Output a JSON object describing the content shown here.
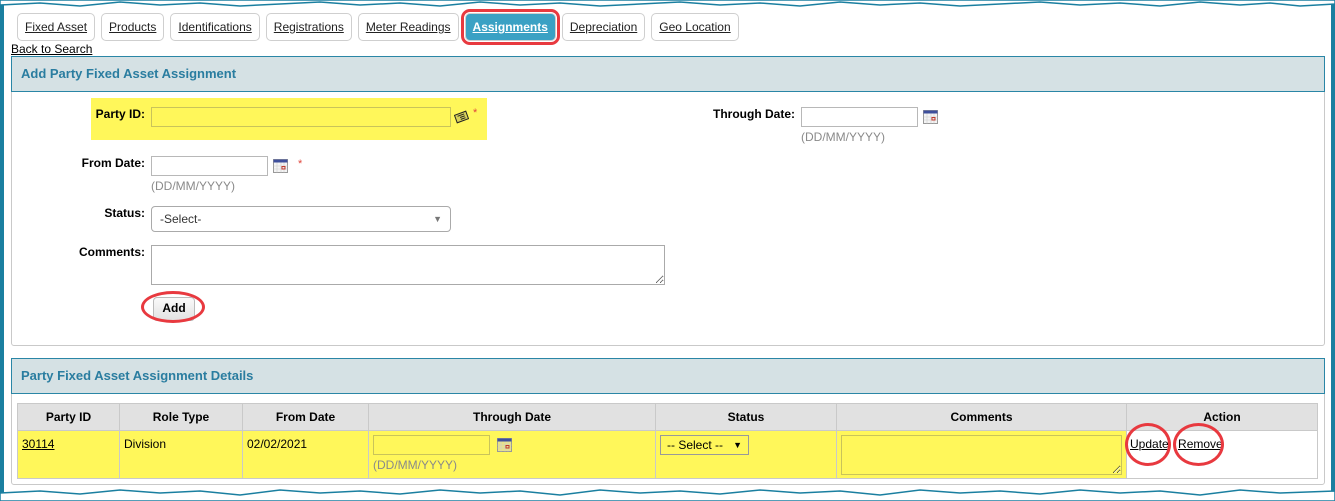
{
  "tabs": [
    {
      "label": "Fixed Asset",
      "active": false
    },
    {
      "label": "Products",
      "active": false
    },
    {
      "label": "Identifications",
      "active": false
    },
    {
      "label": "Registrations",
      "active": false
    },
    {
      "label": "Meter Readings",
      "active": false
    },
    {
      "label": "Assignments",
      "active": true
    },
    {
      "label": "Depreciation",
      "active": false
    },
    {
      "label": "Geo Location",
      "active": false
    }
  ],
  "back_link": "Back to Search",
  "add_form": {
    "title": "Add Party Fixed Asset Assignment",
    "party_id": {
      "label": "Party ID:",
      "value": "",
      "required": "*"
    },
    "from_date": {
      "label": "From Date:",
      "value": "",
      "hint": "(DD/MM/YYYY)",
      "required": "*"
    },
    "through_date": {
      "label": "Through Date:",
      "value": "",
      "hint": "(DD/MM/YYYY)"
    },
    "status": {
      "label": "Status:",
      "selected": "-Select-"
    },
    "comments": {
      "label": "Comments:",
      "value": ""
    },
    "add_button": "Add"
  },
  "details": {
    "title": "Party Fixed Asset Assignment Details",
    "columns": [
      "Party ID",
      "Role Type",
      "From Date",
      "Through Date",
      "Status",
      "Comments",
      "Action"
    ],
    "rows": [
      {
        "party_id": "30114",
        "role_type": "Division",
        "from_date": "02/02/2021",
        "through_date": "",
        "through_hint": "(DD/MM/YYYY)",
        "status": "-- Select --",
        "comments": "",
        "actions": {
          "update": "Update",
          "remove": "Remove"
        }
      }
    ]
  },
  "colors": {
    "accent": "#2a7da0",
    "highlight": "#fff75a",
    "annotation_ring": "#e8393f",
    "active_tab": "#3aa1c4"
  }
}
